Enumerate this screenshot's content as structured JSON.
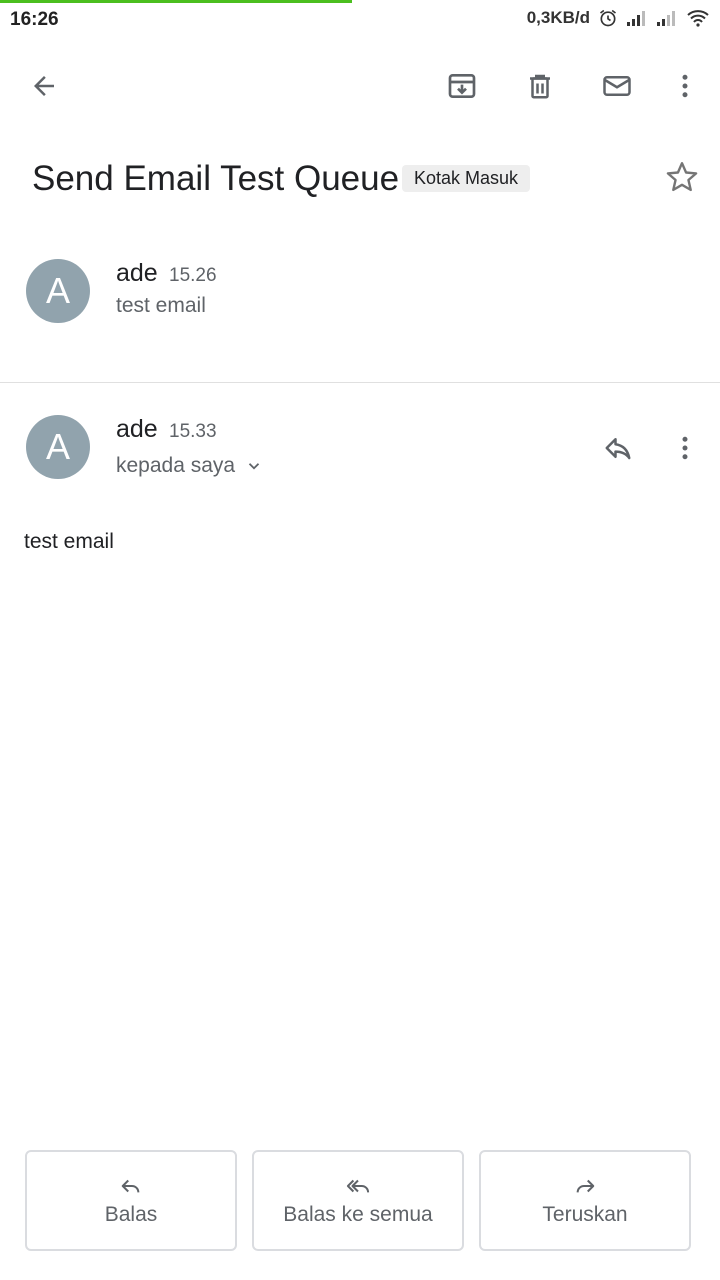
{
  "status_bar": {
    "time": "16:26",
    "speed": "0,3KB/d",
    "icons": [
      "alarm-icon",
      "signal-icon",
      "signal-icon",
      "wifi-icon"
    ]
  },
  "toolbar": {
    "icons": [
      "back-arrow-icon",
      "archive-icon",
      "delete-icon",
      "mail-icon",
      "more-vert-icon"
    ]
  },
  "subject": {
    "title": "Send Email Test Queue",
    "label": "Kotak Masuk"
  },
  "messages": [
    {
      "avatar_letter": "A",
      "sender": "ade",
      "time": "15.26",
      "snippet": "test email"
    },
    {
      "avatar_letter": "A",
      "sender": "ade",
      "time": "15.33",
      "recipients": "kepada saya",
      "body": "test email"
    }
  ],
  "actions": {
    "reply": "Balas",
    "reply_all": "Balas ke semua",
    "forward": "Teruskan"
  },
  "colors": {
    "progress": "#4bbf1f",
    "avatar": "#91a3ad",
    "icon": "#5f6368"
  }
}
